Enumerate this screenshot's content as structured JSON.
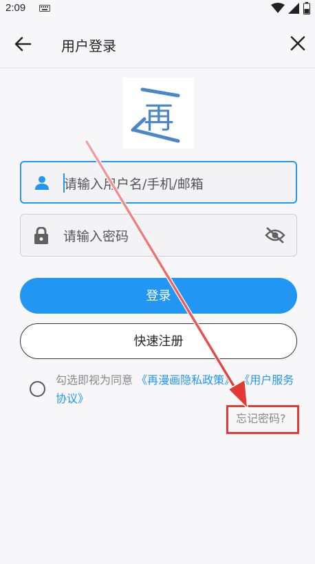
{
  "status_bar": {
    "time": "2:09"
  },
  "app_bar": {
    "title": "用户登录"
  },
  "logo": {
    "char": "再"
  },
  "login_form": {
    "username_placeholder": "请输入用户名/手机/邮箱",
    "password_placeholder": "请输入密码",
    "login_label": "登录",
    "register_label": "快速注册"
  },
  "agreement": {
    "prefix": "勾选即视为同意",
    "privacy_link": "《再漫画隐私政策》",
    "service_link": "《用户服务协议》"
  },
  "forgot_password": "忘记密码?",
  "colors": {
    "accent": "#2196f3",
    "annotation": "#e53935"
  }
}
